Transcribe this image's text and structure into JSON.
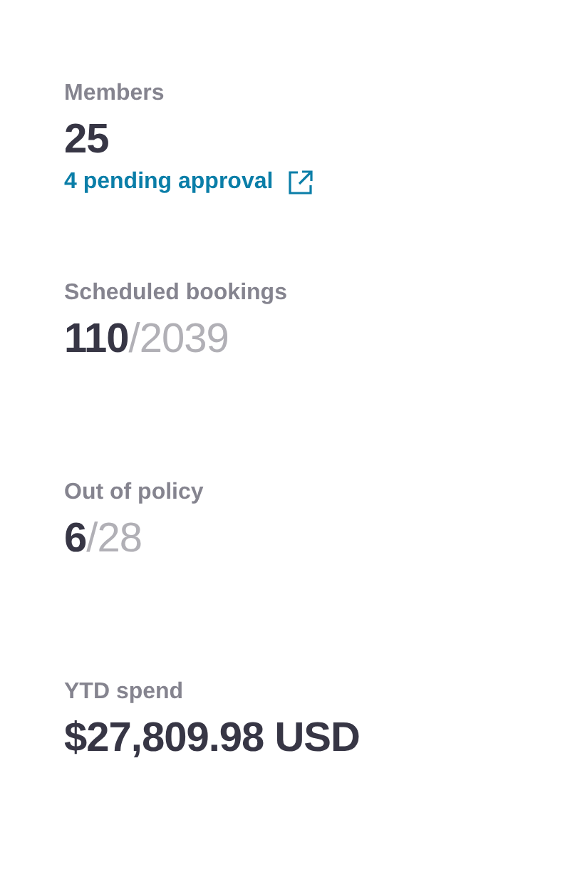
{
  "stats": [
    {
      "label": "Members",
      "value": "25",
      "link": {
        "text": "4 pending approval"
      }
    },
    {
      "label": "Scheduled bookings",
      "value": "110",
      "total": "/2039"
    },
    {
      "label": "Out of policy",
      "value": "6",
      "total": "/28"
    },
    {
      "label": "YTD spend",
      "value": "$27,809.98 USD"
    }
  ]
}
